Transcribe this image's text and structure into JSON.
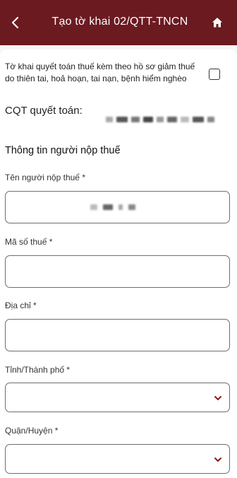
{
  "header": {
    "title": "Tạo tờ khai 02/QTT-TNCN"
  },
  "declaration": {
    "disaster_text": "Tờ khai quyết toán thuế kèm theo hồ sơ giảm thuế do thiên tai, hoả hoạn, tai nạn, bệnh hiểm nghèo",
    "checked": false
  },
  "cqt": {
    "label": "CQT quyết toán:"
  },
  "section": {
    "title": "Thông tin người nộp thuế"
  },
  "fields": {
    "taxpayer_name": {
      "label": "Tên người nộp thuế",
      "required_mark": "*"
    },
    "tax_code": {
      "label": "Mã số thuế",
      "required_mark": "*",
      "value": ""
    },
    "address": {
      "label": "Địa chỉ",
      "required_mark": "*",
      "value": ""
    },
    "province": {
      "label": "Tỉnh/Thành phố",
      "required_mark": "*",
      "value": ""
    },
    "district": {
      "label": "Quận/Huyện",
      "required_mark": "*",
      "value": ""
    }
  },
  "colors": {
    "header_bg": "#6b1a20",
    "chevron": "#8b1a1a"
  },
  "icons": {
    "back": "chevron-left-icon",
    "home": "home-icon",
    "select_arrow": "chevron-down-icon"
  }
}
